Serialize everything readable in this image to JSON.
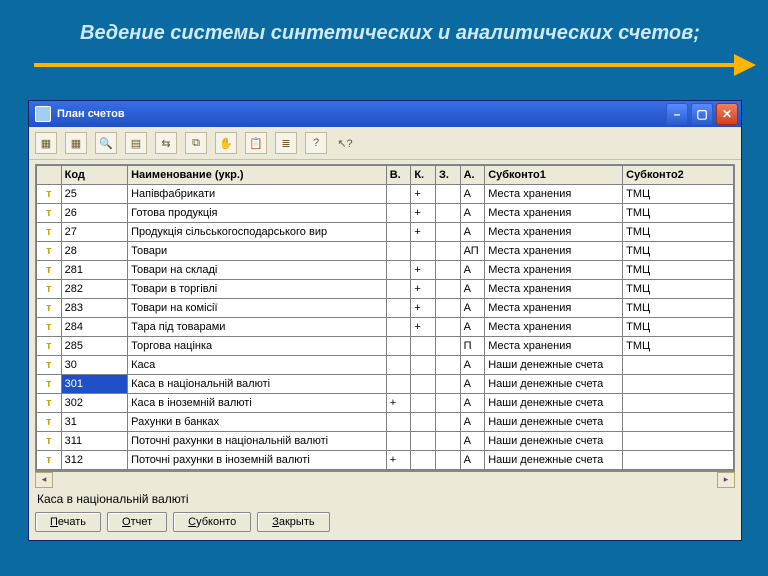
{
  "slide_title": "Ведение системы синтетических и аналитических счетов;",
  "window": {
    "title": "План счетов",
    "status": "Каса в національній валюті",
    "buttons": {
      "print": "Печать",
      "report": "Отчет",
      "subkonto": "Субконто",
      "close": "Закрыть"
    },
    "columns": {
      "code": "Код",
      "name": "Наименование (укр.)",
      "v": "В.",
      "k": "К.",
      "z": "З.",
      "a": "А.",
      "sub1": "Субконто1",
      "sub2": "Субконто2"
    },
    "rows": [
      {
        "code": "25",
        "name": "Напівфабрикати",
        "v": "",
        "k": "+",
        "z": "",
        "a": "А",
        "s1": "Места хранения",
        "s2": "ТМЦ",
        "sel": false
      },
      {
        "code": "26",
        "name": "Готова продукція",
        "v": "",
        "k": "+",
        "z": "",
        "a": "А",
        "s1": "Места хранения",
        "s2": "ТМЦ",
        "sel": false
      },
      {
        "code": "27",
        "name": "Продукція сільськогосподарського вир",
        "v": "",
        "k": "+",
        "z": "",
        "a": "А",
        "s1": "Места хранения",
        "s2": "ТМЦ",
        "sel": false
      },
      {
        "code": "28",
        "name": "Товари",
        "v": "",
        "k": "",
        "z": "",
        "a": "АП",
        "s1": "Места хранения",
        "s2": "ТМЦ",
        "sel": false
      },
      {
        "code": "281",
        "name": "Товари на складі",
        "v": "",
        "k": "+",
        "z": "",
        "a": "А",
        "s1": "Места хранения",
        "s2": "ТМЦ",
        "sel": false
      },
      {
        "code": "282",
        "name": "Товари  в торгівлі",
        "v": "",
        "k": "+",
        "z": "",
        "a": "А",
        "s1": "Места хранения",
        "s2": "ТМЦ",
        "sel": false
      },
      {
        "code": "283",
        "name": "Товари на комісії",
        "v": "",
        "k": "+",
        "z": "",
        "a": "А",
        "s1": "Места хранения",
        "s2": "ТМЦ",
        "sel": false
      },
      {
        "code": "284",
        "name": "Тара під товарами",
        "v": "",
        "k": "+",
        "z": "",
        "a": "А",
        "s1": "Места хранения",
        "s2": "ТМЦ",
        "sel": false
      },
      {
        "code": "285",
        "name": "Торгова націнка",
        "v": "",
        "k": "",
        "z": "",
        "a": "П",
        "s1": "Места хранения",
        "s2": "ТМЦ",
        "sel": false
      },
      {
        "code": "30",
        "name": "Каса",
        "v": "",
        "k": "",
        "z": "",
        "a": "А",
        "s1": "Наши денежные счета",
        "s2": "",
        "sel": false
      },
      {
        "code": "301",
        "name": "Каса в національній валюті",
        "v": "",
        "k": "",
        "z": "",
        "a": "А",
        "s1": "Наши денежные счета",
        "s2": "",
        "sel": true
      },
      {
        "code": "302",
        "name": "Каса в іноземній валюті",
        "v": "+",
        "k": "",
        "z": "",
        "a": "А",
        "s1": "Наши денежные счета",
        "s2": "",
        "sel": false
      },
      {
        "code": "31",
        "name": "Рахунки в банках",
        "v": "",
        "k": "",
        "z": "",
        "a": "А",
        "s1": "Наши денежные счета",
        "s2": "",
        "sel": false
      },
      {
        "code": "311",
        "name": "Поточні рахунки в національній валюті",
        "v": "",
        "k": "",
        "z": "",
        "a": "А",
        "s1": "Наши денежные счета",
        "s2": "",
        "sel": false
      },
      {
        "code": "312",
        "name": "Поточні рахунки в іноземній валюті",
        "v": "+",
        "k": "",
        "z": "",
        "a": "А",
        "s1": "Наши денежные счета",
        "s2": "",
        "sel": false
      }
    ]
  }
}
